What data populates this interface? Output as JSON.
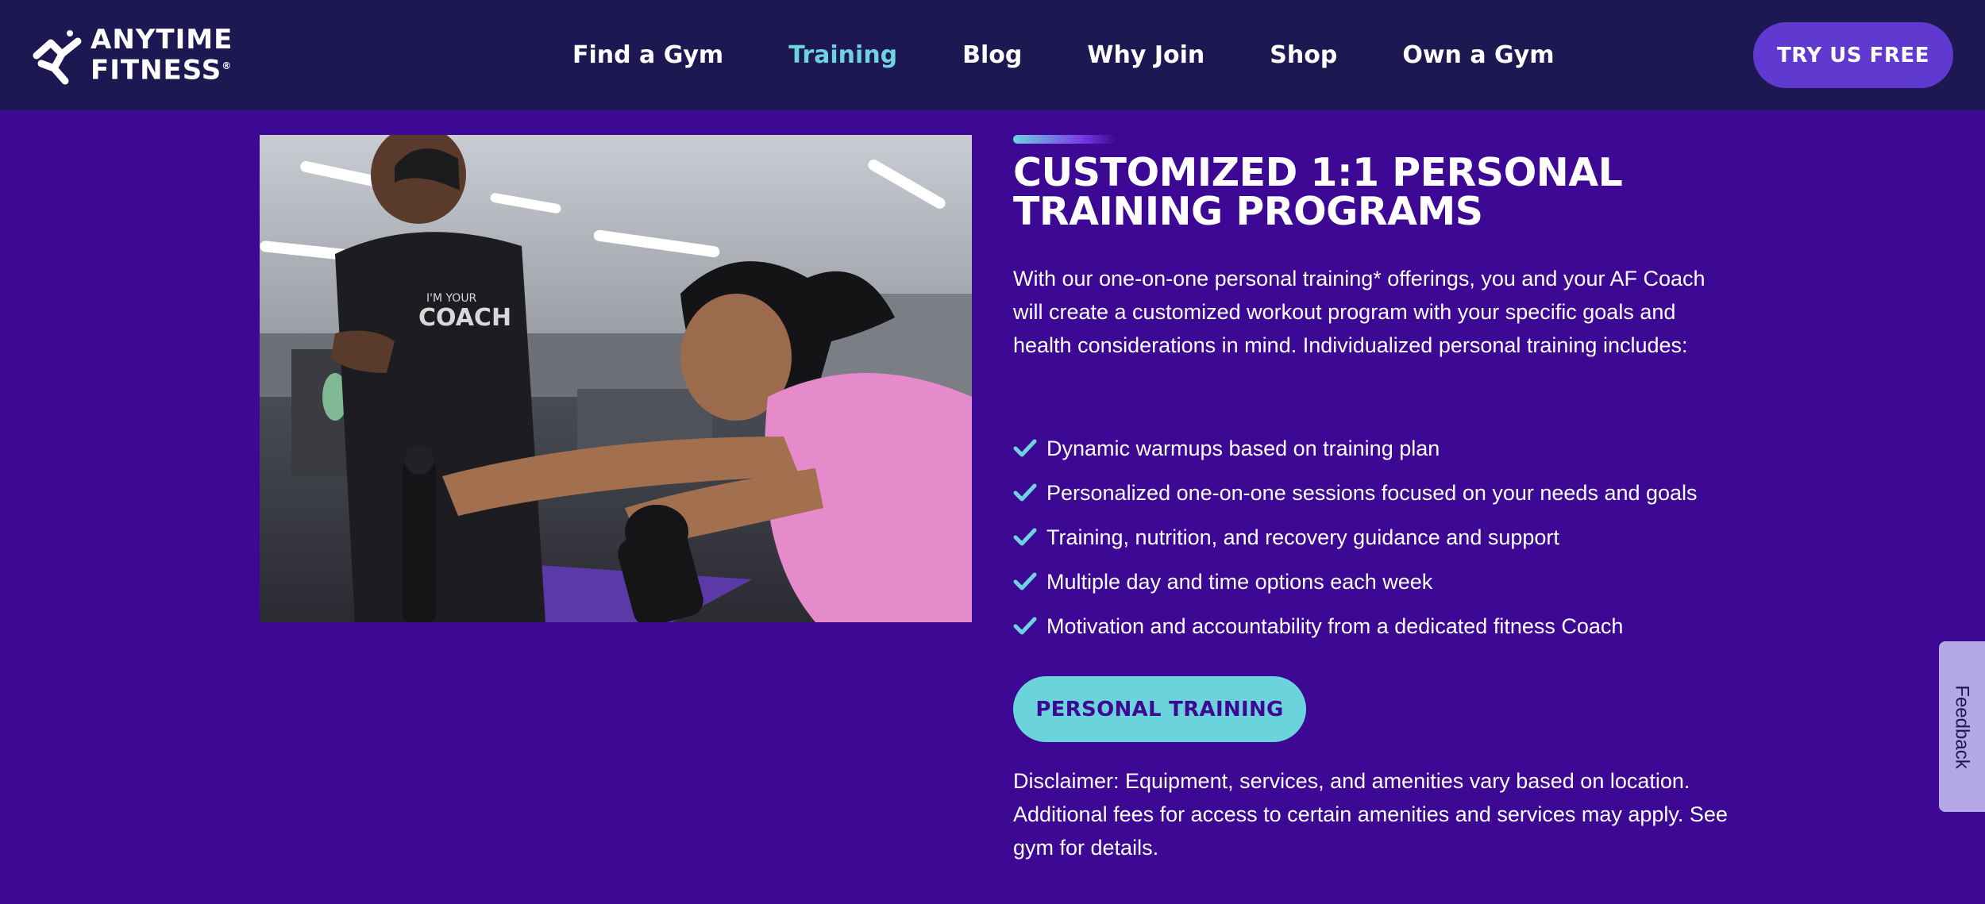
{
  "brand": {
    "logo_line1": "ANYTIME",
    "logo_line2": "FITNESS",
    "logo_mark": "®"
  },
  "nav": {
    "items": [
      {
        "label": "Find a Gym",
        "active": false
      },
      {
        "label": "Training",
        "active": true
      },
      {
        "label": "Blog",
        "active": false
      },
      {
        "label": "Why Join",
        "active": false
      },
      {
        "label": "Shop",
        "active": false
      },
      {
        "label": "Own a Gym",
        "active": false
      }
    ],
    "cta_label": "TRY US FREE"
  },
  "section": {
    "title_line1": "CUSTOMIZED 1:1 PERSONAL",
    "title_line2": "TRAINING PROGRAMS",
    "intro": "With our one-on-one personal training* offerings, you and your AF Coach will create a customized workout program with your specific goals and health considerations in mind. Individualized personal training includes:",
    "features": [
      "Dynamic warmups based on training plan",
      "Personalized one-on-one sessions focused on your needs and goals",
      "Training, nutrition, and recovery guidance and support",
      "Multiple day and time options each week",
      "Motivation and accountability from a dedicated fitness Coach"
    ],
    "button_label": "PERSONAL TRAINING",
    "disclaimer": "Disclaimer: Equipment, services, and amenities vary based on location. Additional fees for access to certain amenities and services may apply. See gym for details."
  },
  "image": {
    "shirt_line1": "I'M YOUR",
    "shirt_line2": "COACH",
    "icon": "photo-coach-training-member"
  },
  "feedback": {
    "label": "Feedback"
  },
  "colors": {
    "header_bg": "#1e1852",
    "page_bg": "#3d0893",
    "nav_active": "#6fd3df",
    "cta_bg": "#6039d1",
    "secondary_button_bg": "#6ad3dc",
    "check": "#6fd3df",
    "feedback_bg": "#b4a7e8"
  }
}
